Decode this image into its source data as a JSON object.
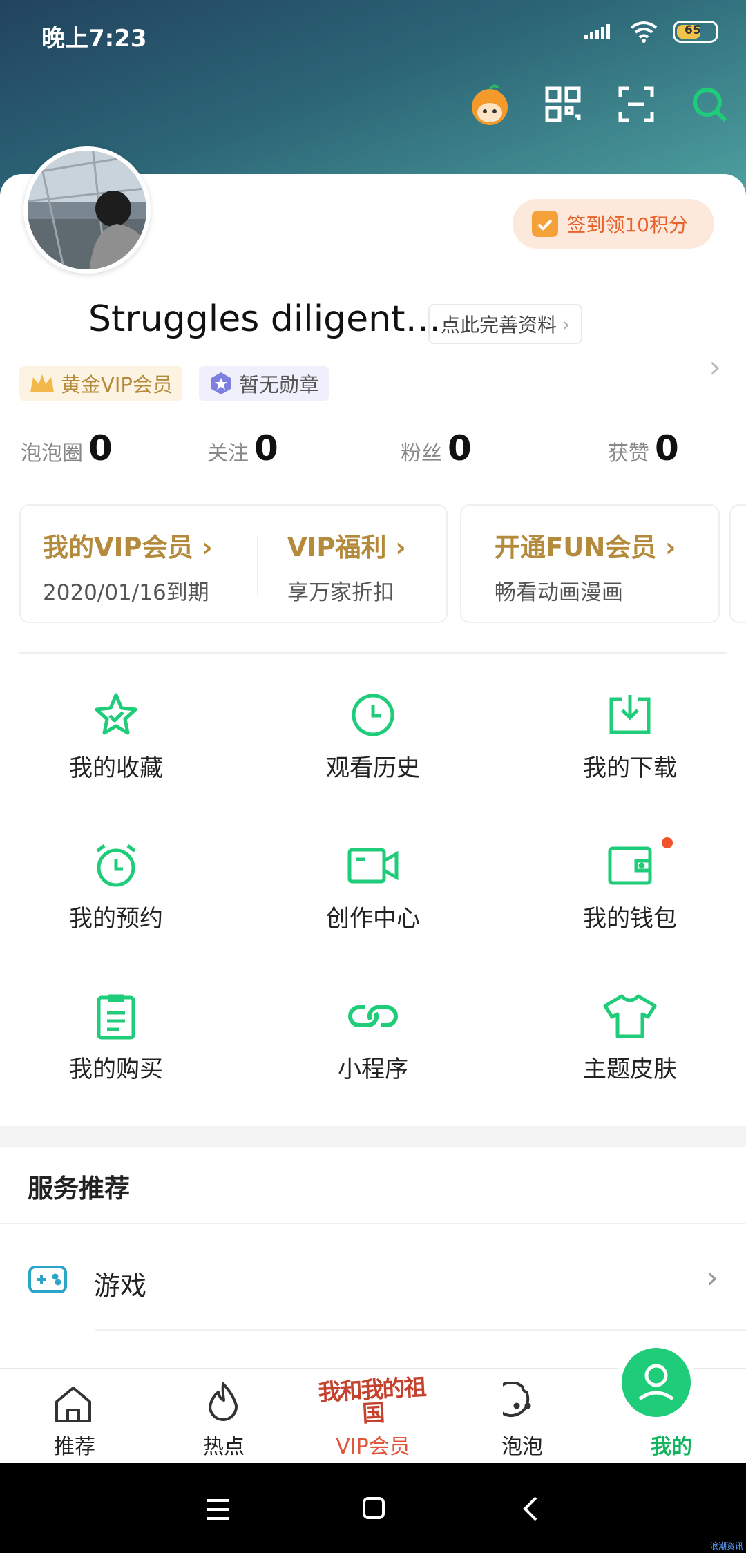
{
  "status": {
    "time": "晚上7:23",
    "battery": "65"
  },
  "profile": {
    "checkin": "签到领10积分",
    "username": "Struggles diligent…",
    "edit_label": "点此完善资料",
    "vip_badge": "黄金VIP会员",
    "medal_badge": "暂无勋章"
  },
  "stats": [
    {
      "label": "泡泡圈",
      "value": "0"
    },
    {
      "label": "关注",
      "value": "0"
    },
    {
      "label": "粉丝",
      "value": "0"
    },
    {
      "label": "获赞",
      "value": "0"
    }
  ],
  "vip": {
    "my_vip_title": "我的VIP会员 ›",
    "my_vip_sub": "2020/01/16到期",
    "welfare_title": "VIP福利 ›",
    "welfare_sub": "享万家折扣",
    "fun_title": "开通FUN会员 ›",
    "fun_sub": "畅看动画漫画"
  },
  "grid": [
    {
      "label": "我的收藏",
      "icon": "star-icon"
    },
    {
      "label": "观看历史",
      "icon": "clock-icon"
    },
    {
      "label": "我的下载",
      "icon": "download-icon"
    },
    {
      "label": "我的预约",
      "icon": "alarm-icon"
    },
    {
      "label": "创作中心",
      "icon": "video-camera-icon"
    },
    {
      "label": "我的钱包",
      "icon": "wallet-icon"
    },
    {
      "label": "我的购买",
      "icon": "clipboard-icon"
    },
    {
      "label": "小程序",
      "icon": "link-icon"
    },
    {
      "label": "主题皮肤",
      "icon": "tshirt-icon"
    }
  ],
  "services": {
    "title": "服务推荐",
    "items": [
      {
        "label": "游戏",
        "icon": "gamepad-icon"
      }
    ]
  },
  "tabs": [
    {
      "label": "推荐",
      "icon": "home-icon"
    },
    {
      "label": "热点",
      "icon": "flame-icon"
    },
    {
      "label": "VIP会员",
      "icon": "vip-promo-icon",
      "promo": "我和我的祖国"
    },
    {
      "label": "泡泡",
      "icon": "bubble-face-icon"
    },
    {
      "label": "我的",
      "icon": "profile-icon"
    }
  ],
  "colors": {
    "accent": "#1fcc7a",
    "gold": "#b48a3c",
    "checkin": "#e8622b"
  },
  "watermark": "浪潮资讯"
}
